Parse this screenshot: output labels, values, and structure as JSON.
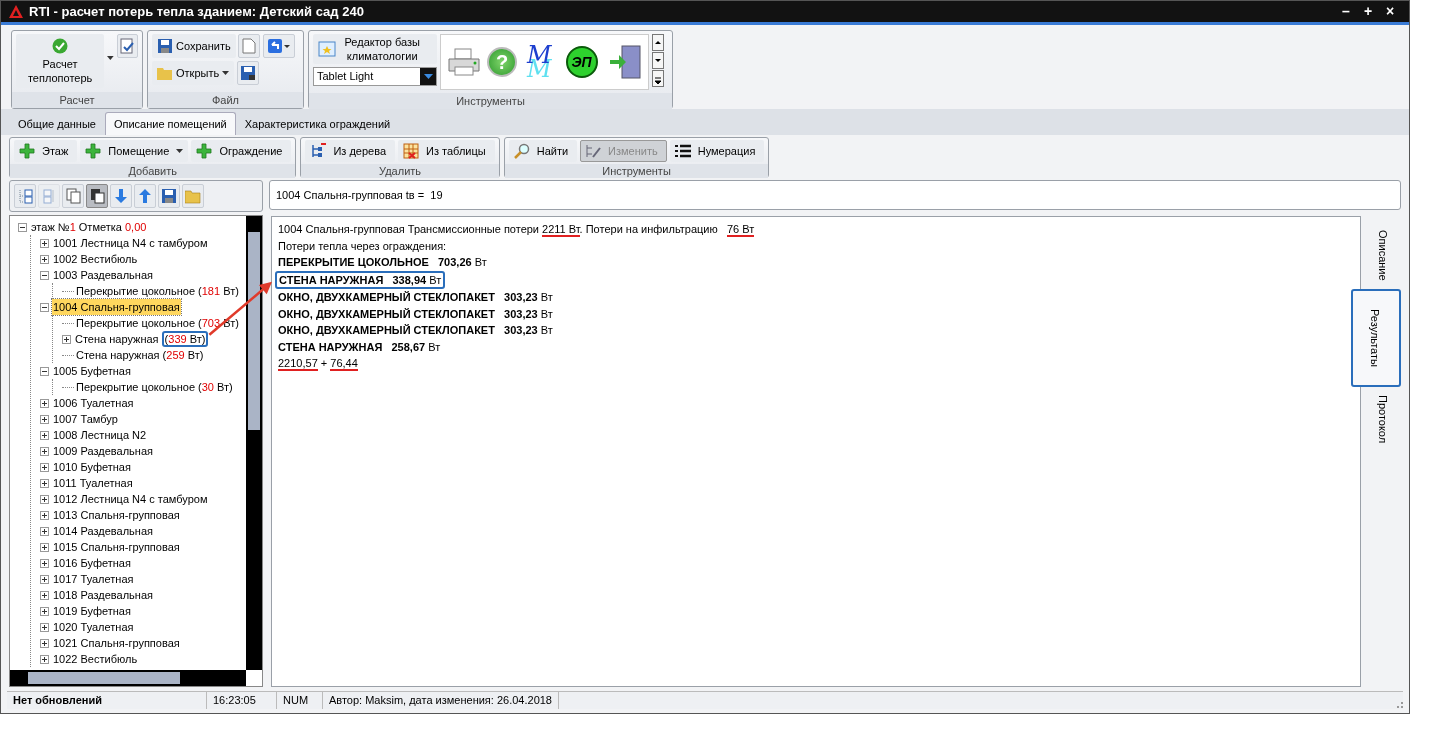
{
  "window": {
    "title": "RTI - расчет потерь тепла зданием: Детский сад 240",
    "controls": [
      "–",
      "+",
      "×"
    ]
  },
  "ribbon": {
    "calc": {
      "button": "Расчет\nтеплопотерь",
      "group": "Расчет"
    },
    "file": {
      "save": "Сохранить",
      "open": "Открыть",
      "group": "Файл"
    },
    "tools": {
      "climate": "Редактор базы\nклиматологии",
      "theme": "Tablet Light",
      "group": "Инструменты",
      "gallery": [
        {
          "kind": "printer"
        },
        {
          "kind": "help",
          "text": "?"
        },
        {
          "kind": "monogram",
          "text": "M"
        },
        {
          "kind": "badge",
          "text": "ЭП"
        },
        {
          "kind": "exit"
        }
      ]
    }
  },
  "tabs": [
    {
      "label": "Общие данные",
      "selected": false
    },
    {
      "label": "Описание помещений",
      "selected": true
    },
    {
      "label": "Характеристика ограждений",
      "selected": false
    }
  ],
  "toolbar": [
    {
      "group": "Добавить",
      "buttons": [
        {
          "label": "Этаж",
          "kind": "add",
          "dropdown": false,
          "disabled": false
        },
        {
          "label": "Помещение",
          "kind": "add",
          "dropdown": true,
          "disabled": false
        },
        {
          "label": "Ограждение",
          "kind": "add",
          "dropdown": false,
          "disabled": false
        }
      ]
    },
    {
      "group": "Удалить",
      "buttons": [
        {
          "label": "Из дерева",
          "kind": "tree",
          "dropdown": false,
          "disabled": false
        },
        {
          "label": "Из таблицы",
          "kind": "table",
          "dropdown": false,
          "disabled": false
        }
      ]
    },
    {
      "group": "Инструменты",
      "buttons": [
        {
          "label": "Найти",
          "kind": "find",
          "dropdown": false,
          "disabled": false
        },
        {
          "label": "Изменить",
          "kind": "edit",
          "dropdown": false,
          "disabled": true
        },
        {
          "label": "Нумерация",
          "kind": "numbering",
          "dropdown": false,
          "disabled": false
        }
      ]
    }
  ],
  "tree_toolbar": [
    {
      "pressed": false,
      "disabled": false
    },
    {
      "pressed": false,
      "disabled": true
    },
    {
      "pressed": false,
      "disabled": false
    },
    {
      "pressed": true,
      "disabled": false
    },
    {
      "pressed": false,
      "disabled": false
    },
    {
      "pressed": false,
      "disabled": false
    },
    {
      "pressed": false,
      "disabled": false
    },
    {
      "pressed": false,
      "disabled": false
    }
  ],
  "tree": [
    {
      "parts": [
        {
          "text": "этаж №"
        },
        {
          "text": "1",
          "red": true
        },
        {
          "text": " Отметка "
        },
        {
          "text": "0,00",
          "red": true
        }
      ],
      "expanded": true,
      "selected": false,
      "children": [
        {
          "parts": [
            {
              "text": "1001 Лестница N4 с тамбуром"
            }
          ],
          "expanded": false,
          "selected": false
        },
        {
          "parts": [
            {
              "text": "1002 Вестибюль"
            }
          ],
          "expanded": false,
          "selected": false
        },
        {
          "parts": [
            {
              "text": "1003 Раздевальная"
            }
          ],
          "expanded": true,
          "selected": false,
          "children": [
            {
              "parts": [
                {
                  "text": "Перекрытие цокольное "
                }
              ],
              "reading": {
                "parts": [
                  {
                    "text": "("
                  },
                  {
                    "text": "181",
                    "red": true
                  },
                  {
                    "text": " Вт)"
                  }
                ],
                "boxed": false
              },
              "selected": false
            }
          ]
        },
        {
          "parts": [
            {
              "text": "1004 Спальня-групповая"
            }
          ],
          "expanded": true,
          "selected": true,
          "children": [
            {
              "parts": [
                {
                  "text": "Перекрытие цокольное "
                }
              ],
              "reading": {
                "parts": [
                  {
                    "text": "("
                  },
                  {
                    "text": "703",
                    "red": true
                  },
                  {
                    "text": " Вт)"
                  }
                ],
                "boxed": false
              },
              "selected": false
            },
            {
              "parts": [
                {
                  "text": "Стена наружная "
                }
              ],
              "reading": {
                "parts": [
                  {
                    "text": "("
                  },
                  {
                    "text": "339",
                    "red": true
                  },
                  {
                    "text": " Вт)"
                  }
                ],
                "boxed": true
              },
              "expanded": false,
              "selected": false
            },
            {
              "parts": [
                {
                  "text": "Стена наружная "
                }
              ],
              "reading": {
                "parts": [
                  {
                    "text": "("
                  },
                  {
                    "text": "259",
                    "red": true
                  },
                  {
                    "text": " Вт)"
                  }
                ],
                "boxed": false
              },
              "selected": false
            }
          ]
        },
        {
          "parts": [
            {
              "text": "1005 Буфетная"
            }
          ],
          "expanded": true,
          "selected": false,
          "children": [
            {
              "parts": [
                {
                  "text": "Перекрытие цокольное "
                }
              ],
              "reading": {
                "parts": [
                  {
                    "text": "("
                  },
                  {
                    "text": "30",
                    "red": true
                  },
                  {
                    "text": " Вт)"
                  }
                ],
                "boxed": false
              },
              "selected": false
            }
          ]
        },
        {
          "parts": [
            {
              "text": "1006 Туалетная"
            }
          ],
          "expanded": false,
          "selected": false
        },
        {
          "parts": [
            {
              "text": "1007 Тамбур"
            }
          ],
          "expanded": false,
          "selected": false
        },
        {
          "parts": [
            {
              "text": "1008 Лестница N2"
            }
          ],
          "expanded": false,
          "selected": false
        },
        {
          "parts": [
            {
              "text": "1009 Раздевальная"
            }
          ],
          "expanded": false,
          "selected": false
        },
        {
          "parts": [
            {
              "text": "1010 Буфетная"
            }
          ],
          "expanded": false,
          "selected": false
        },
        {
          "parts": [
            {
              "text": "1011 Туалетная"
            }
          ],
          "expanded": false,
          "selected": false
        },
        {
          "parts": [
            {
              "text": "1012 Лестница N4 с тамбуром"
            }
          ],
          "expanded": false,
          "selected": false
        },
        {
          "parts": [
            {
              "text": "1013 Спальня-групповая"
            }
          ],
          "expanded": false,
          "selected": false
        },
        {
          "parts": [
            {
              "text": "1014 Раздевальная"
            }
          ],
          "expanded": false,
          "selected": false
        },
        {
          "parts": [
            {
              "text": "1015 Спальня-групповая"
            }
          ],
          "expanded": false,
          "selected": false
        },
        {
          "parts": [
            {
              "text": "1016 Буфетная"
            }
          ],
          "expanded": false,
          "selected": false
        },
        {
          "parts": [
            {
              "text": "1017 Туалетная"
            }
          ],
          "expanded": false,
          "selected": false
        },
        {
          "parts": [
            {
              "text": "1018 Раздевальная"
            }
          ],
          "expanded": false,
          "selected": false
        },
        {
          "parts": [
            {
              "text": "1019 Буфетная"
            }
          ],
          "expanded": false,
          "selected": false
        },
        {
          "parts": [
            {
              "text": "1020 Туалетная"
            }
          ],
          "expanded": false,
          "selected": false
        },
        {
          "parts": [
            {
              "text": "1021 Спальня-групповая"
            }
          ],
          "expanded": false,
          "selected": false
        },
        {
          "parts": [
            {
              "text": "1022 Вестибюль"
            }
          ],
          "expanded": false,
          "selected": false
        }
      ]
    }
  ],
  "header_field": {
    "value": "1004 Спальня-групповая tв =  19"
  },
  "results": [
    {
      "boxed": false,
      "parts": [
        {
          "text": "1004 Спальня-групповая Трансмиссионные потери "
        },
        {
          "text": "2211 Вт",
          "underlined": true
        },
        {
          "text": ". Потери на инфильтрацию   "
        },
        {
          "text": "76 Вт",
          "underlined": true
        }
      ]
    },
    {
      "boxed": false,
      "parts": [
        {
          "text": "Потери тепла через ограждения:"
        }
      ]
    },
    {
      "boxed": false,
      "parts": [
        {
          "text": "ПЕРЕКРЫТИЕ ЦОКОЛЬНОЕ   703,26",
          "bold": true
        },
        {
          "text": " Вт"
        }
      ]
    },
    {
      "boxed": true,
      "parts": [
        {
          "text": "СТЕНА НАРУЖНАЯ   338,94",
          "bold": true
        },
        {
          "text": " Вт"
        }
      ]
    },
    {
      "boxed": false,
      "parts": [
        {
          "text": "ОКНО, ДВУХКАМЕРНЫЙ СТЕКЛОПАКЕТ   303,23",
          "bold": true
        },
        {
          "text": " Вт"
        }
      ]
    },
    {
      "boxed": false,
      "parts": [
        {
          "text": "ОКНО, ДВУХКАМЕРНЫЙ СТЕКЛОПАКЕТ   303,23",
          "bold": true
        },
        {
          "text": " Вт"
        }
      ]
    },
    {
      "boxed": false,
      "parts": [
        {
          "text": "ОКНО, ДВУХКАМЕРНЫЙ СТЕКЛОПАКЕТ   303,23",
          "bold": true
        },
        {
          "text": " Вт"
        }
      ]
    },
    {
      "boxed": false,
      "parts": [
        {
          "text": "СТЕНА НАРУЖНАЯ   258,67",
          "bold": true
        },
        {
          "text": " Вт"
        }
      ]
    },
    {
      "boxed": false,
      "parts": [
        {
          "text": "2210,57",
          "underlined": true
        },
        {
          "text": " + "
        },
        {
          "text": "76,44",
          "underlined": true
        }
      ]
    }
  ],
  "side_tabs": [
    {
      "label": "Описание",
      "selected": false
    },
    {
      "label": "Результаты",
      "selected": true
    },
    {
      "label": "Протокол",
      "selected": false
    }
  ],
  "status_bar": [
    {
      "text": "Нет обновлений",
      "bold": true
    },
    {
      "text": "16:23:05",
      "bold": false
    },
    {
      "text": "NUM",
      "bold": false
    },
    {
      "text": "Автор: Maksim, дата изменения: 26.04.2018",
      "bold": false
    }
  ]
}
